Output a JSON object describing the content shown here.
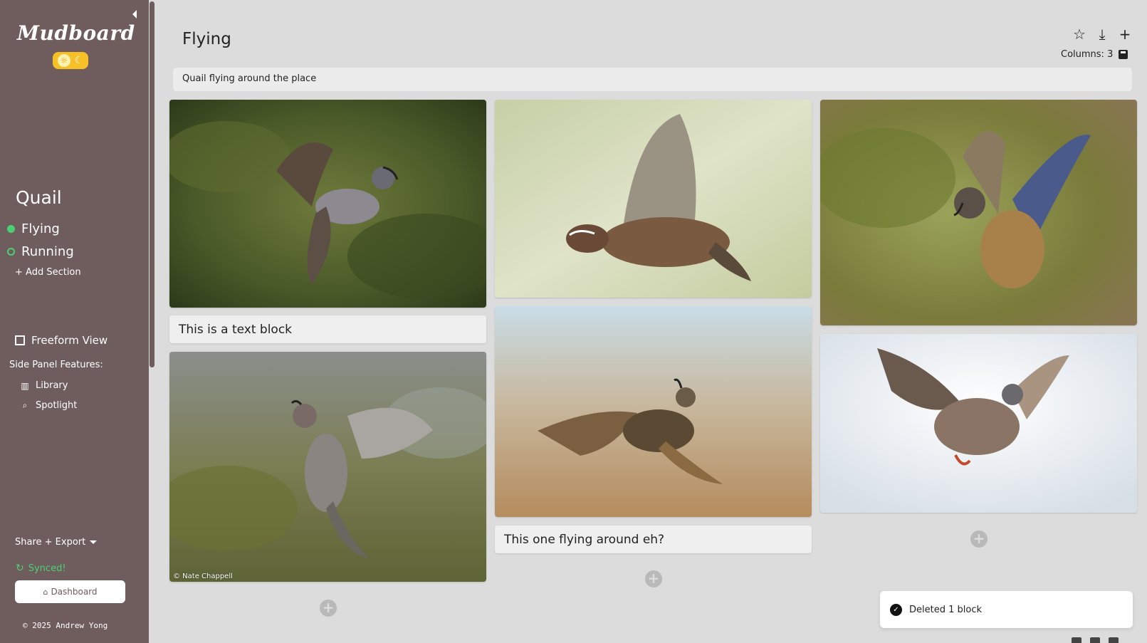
{
  "app": {
    "logo_text": "Mudboard",
    "sun_glyph": "☼",
    "moon_glyph": "☾"
  },
  "sidebar": {
    "board_title": "Quail",
    "sections": [
      {
        "label": "Flying",
        "active": true
      },
      {
        "label": "Running",
        "active": false
      }
    ],
    "add_section_label": "+ Add Section",
    "freeform_label": "Freeform View",
    "side_panel_label": "Side Panel Features:",
    "side_panel_items": [
      {
        "label": "Library",
        "icon": "library-icon",
        "glyph": "▥"
      },
      {
        "label": "Spotlight",
        "icon": "search-icon",
        "glyph": "⌕"
      }
    ],
    "share_label": "Share + Export",
    "synced_label": "Synced!",
    "synced_glyph": "↻",
    "dashboard_label": "Dashboard",
    "dashboard_glyph": "⌂",
    "copyright": "© 2025 Andrew Yong"
  },
  "header": {
    "title": "Flying",
    "columns_label": "Columns: 3",
    "star_glyph": "☆",
    "download_glyph": "⤓",
    "add_glyph": "+"
  },
  "description": "Quail flying around the place",
  "blocks": {
    "text_block_1": "This is a text block",
    "text_block_2": "This one flying around eh?",
    "photo_credit": "© Nate Chappell"
  },
  "add_block_glyph": "+",
  "toast": {
    "message": "Deleted 1 block",
    "glyph": "✓"
  },
  "colors": {
    "sidebar": "#6f5c5c",
    "accent_green": "#4ccf74",
    "toggle_yellow": "#f6c026",
    "background": "#dcdcdc"
  }
}
